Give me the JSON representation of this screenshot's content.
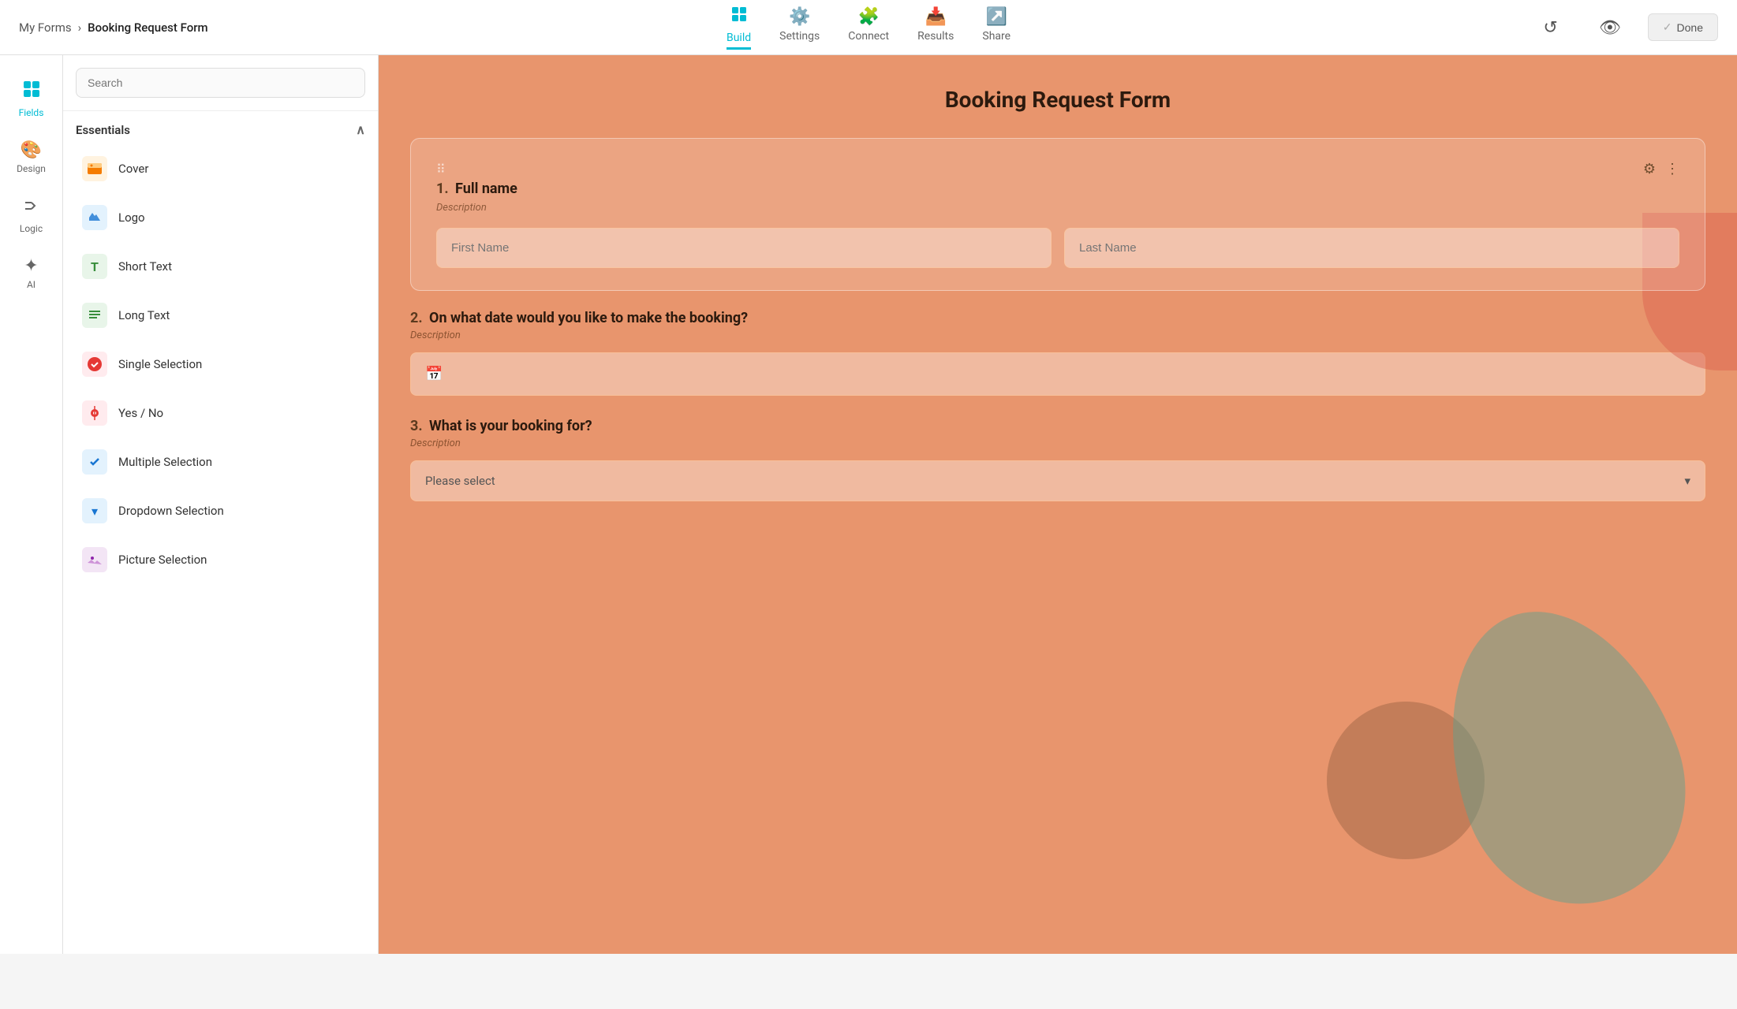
{
  "app": {
    "breadcrumb_parent": "My Forms",
    "breadcrumb_sep": "›",
    "breadcrumb_current": "Booking Request Form",
    "form_title": "Booking Request Form"
  },
  "header": {
    "nav": [
      {
        "id": "build",
        "label": "Build",
        "icon": "🗂",
        "active": true
      },
      {
        "id": "settings",
        "label": "Settings",
        "icon": "⚙️",
        "active": false
      },
      {
        "id": "connect",
        "label": "Connect",
        "icon": "🧩",
        "active": false
      },
      {
        "id": "results",
        "label": "Results",
        "icon": "📥",
        "active": false
      },
      {
        "id": "share",
        "label": "Share",
        "icon": "↗️",
        "active": false
      }
    ],
    "done_label": "Done",
    "history_icon": "↺",
    "preview_icon": "👁"
  },
  "sidebar_icons": [
    {
      "id": "fields",
      "label": "Fields",
      "icon": "◈",
      "active": true
    },
    {
      "id": "design",
      "label": "Design",
      "icon": "🎨",
      "active": false
    },
    {
      "id": "logic",
      "label": "Logic",
      "icon": "✕+",
      "active": false
    },
    {
      "id": "ai",
      "label": "AI",
      "icon": "✦",
      "active": false
    }
  ],
  "fields_panel": {
    "search_placeholder": "Search",
    "section_label": "Essentials",
    "fields": [
      {
        "id": "cover",
        "label": "Cover",
        "icon": "🖼",
        "color_class": "icon-cover"
      },
      {
        "id": "logo",
        "label": "Logo",
        "icon": "🏷",
        "color_class": "icon-logo"
      },
      {
        "id": "short-text",
        "label": "Short Text",
        "icon": "T",
        "color_class": "icon-short-text"
      },
      {
        "id": "long-text",
        "label": "Long Text",
        "icon": "≡",
        "color_class": "icon-long-text"
      },
      {
        "id": "single-selection",
        "label": "Single Selection",
        "icon": "✔",
        "color_class": "icon-single"
      },
      {
        "id": "yes-no",
        "label": "Yes / No",
        "icon": "☯",
        "color_class": "icon-yes-no"
      },
      {
        "id": "multiple-selection",
        "label": "Multiple Selection",
        "icon": "✔",
        "color_class": "icon-multi"
      },
      {
        "id": "dropdown",
        "label": "Dropdown Selection",
        "icon": "▾",
        "color_class": "icon-dropdown"
      },
      {
        "id": "picture",
        "label": "Picture Selection",
        "icon": "🖼",
        "color_class": "icon-picture"
      }
    ]
  },
  "form": {
    "title": "Booking Request Form",
    "questions": [
      {
        "num": "1.",
        "label": "Full name",
        "description": "Description",
        "type": "name",
        "placeholders": [
          "First Name",
          "Last Name"
        ]
      },
      {
        "num": "2.",
        "label": "On what date would you like to make the booking?",
        "description": "Description",
        "type": "date"
      },
      {
        "num": "3.",
        "label": "What is your booking for?",
        "description": "Description",
        "type": "dropdown",
        "placeholder": "Please select"
      }
    ]
  }
}
